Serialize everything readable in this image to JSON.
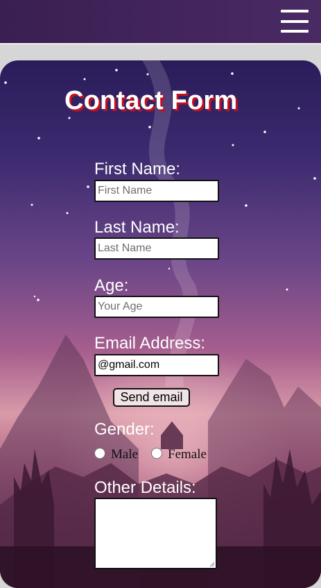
{
  "header": {
    "menu_icon": "hamburger-menu-icon",
    "background": "#3e2257"
  },
  "form": {
    "title": "Contact Form",
    "title_shadow_color": "#c4101e",
    "first_name": {
      "label": "First Name:",
      "placeholder": "First Name",
      "value": ""
    },
    "last_name": {
      "label": "Last Name:",
      "placeholder": "Last Name",
      "value": ""
    },
    "age": {
      "label": "Age:",
      "placeholder": "Your Age",
      "value": ""
    },
    "email": {
      "label": "Email Address:",
      "placeholder": "",
      "value": "@gmail.com"
    },
    "send_button": "Send email",
    "gender": {
      "label": "Gender:",
      "options": [
        {
          "label": "Male",
          "checked": false
        },
        {
          "label": "Female",
          "checked": false
        }
      ]
    },
    "other_details": {
      "label": "Other Details:",
      "value": ""
    }
  }
}
